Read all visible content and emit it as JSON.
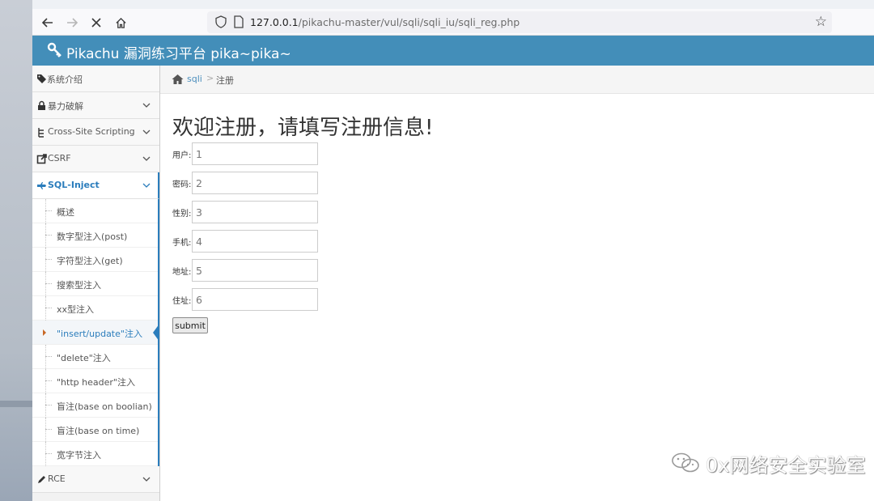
{
  "browser": {
    "url_host": "127.0.0.1",
    "url_path": "/pikachu-master/vul/sqli/sqli_iu/sqli_reg.php",
    "icons": [
      "back-arrow-icon",
      "forward-arrow-icon",
      "stop-loading-icon",
      "home-icon",
      "shield-icon",
      "page-icon",
      "bookmark-star-icon"
    ]
  },
  "app": {
    "title": "Pikachu 漏洞练习平台 pika~pika~",
    "header_color": "#438eb9",
    "accent_color": "#2b7dbc"
  },
  "sidebar": {
    "items": [
      {
        "label": "系统介绍",
        "icon": "tags-icon"
      },
      {
        "label": "暴力破解",
        "icon": "lock-icon"
      },
      {
        "label": "Cross-Site Scripting",
        "icon": "sitemap-icon"
      },
      {
        "label": "CSRF",
        "icon": "external-link-icon"
      },
      {
        "label": "SQL-Inject",
        "icon": "fighter-jet-icon"
      },
      {
        "label": "RCE",
        "icon": "pencil-icon"
      }
    ],
    "sub_items": [
      "概述",
      "数字型注入(post)",
      "字符型注入(get)",
      "搜索型注入",
      "xx型注入",
      "\"insert/update\"注入",
      "\"delete\"注入",
      "\"http header\"注入",
      "盲注(base on boolian)",
      "盲注(base on time)",
      "宽字节注入"
    ]
  },
  "breadcrumb": {
    "parent": "sqli",
    "separator": ">",
    "current": "注册"
  },
  "form": {
    "heading": "欢迎注册，请填写注册信息!",
    "fields": [
      {
        "label": "用户:",
        "value": "1"
      },
      {
        "label": "密码:",
        "value": "2"
      },
      {
        "label": "性别:",
        "value": "3"
      },
      {
        "label": "手机:",
        "value": "4"
      },
      {
        "label": "地址:",
        "value": "5"
      },
      {
        "label": "住址:",
        "value": "6"
      }
    ],
    "submit_label": "submit"
  },
  "watermark": {
    "text": "0x网络安全实验室"
  }
}
